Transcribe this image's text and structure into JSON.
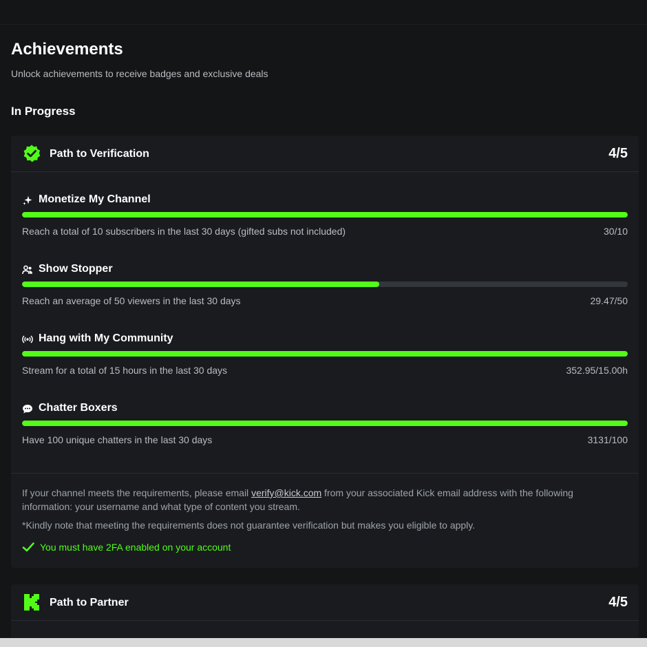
{
  "page": {
    "title": "Achievements",
    "subtitle": "Unlock achievements to receive badges and exclusive deals",
    "section_title": "In Progress"
  },
  "colors": {
    "accent": "#53fc18",
    "background": "#141517",
    "card": "#191b1f",
    "track": "#33363c"
  },
  "verification": {
    "title": "Path to Verification",
    "count": "4/5",
    "icon": "verified-badge-icon",
    "achievements": [
      {
        "title": "Monetize My Channel",
        "icon": "sparkle-icon",
        "description": "Reach a total of 10 subscribers in the last 30 days (gifted subs not included)",
        "value": "30/10",
        "progress": 1.0
      },
      {
        "title": "Show Stopper",
        "icon": "viewers-icon",
        "description": "Reach an average of 50 viewers in the last 30 days",
        "value": "29.47/50",
        "progress": 0.5894
      },
      {
        "title": "Hang with My Community",
        "icon": "broadcast-icon",
        "description": "Stream for a total of 15 hours in the last 30 days",
        "value": "352.95/15.00h",
        "progress": 1.0
      },
      {
        "title": "Chatter Boxers",
        "icon": "chat-bubble-icon",
        "description": "Have 100 unique chatters in the last 30 days",
        "value": "3131/100",
        "progress": 1.0
      }
    ],
    "info_before": "If your channel meets the requirements, please email ",
    "info_email": "verify@kick.com",
    "info_after": " from your associated Kick email address with the following information: your username and what type of content you stream.",
    "note": "*Kindly note that meeting the requirements does not guarantee verification but makes you eligible to apply.",
    "requirement": "You must have 2FA enabled on your account"
  },
  "partner": {
    "title": "Path to Partner",
    "count": "4/5",
    "icon": "kick-logo-icon"
  }
}
